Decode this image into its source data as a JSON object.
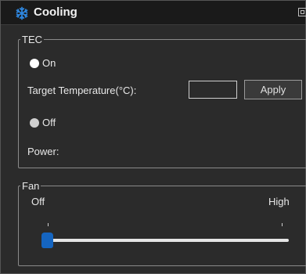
{
  "window": {
    "title": "Cooling",
    "icon": "snowflake-icon",
    "accent_color": "#1565c0"
  },
  "tec": {
    "group_label": "TEC",
    "on_label": "On",
    "off_label": "Off",
    "selected": "none",
    "target_temperature_label": "Target Temperature(°C):",
    "target_temperature_value": "",
    "apply_label": "Apply",
    "power_label": "Power:",
    "power_value": ""
  },
  "fan": {
    "group_label": "Fan",
    "min_label": "Off",
    "max_label": "High",
    "level": 0
  }
}
